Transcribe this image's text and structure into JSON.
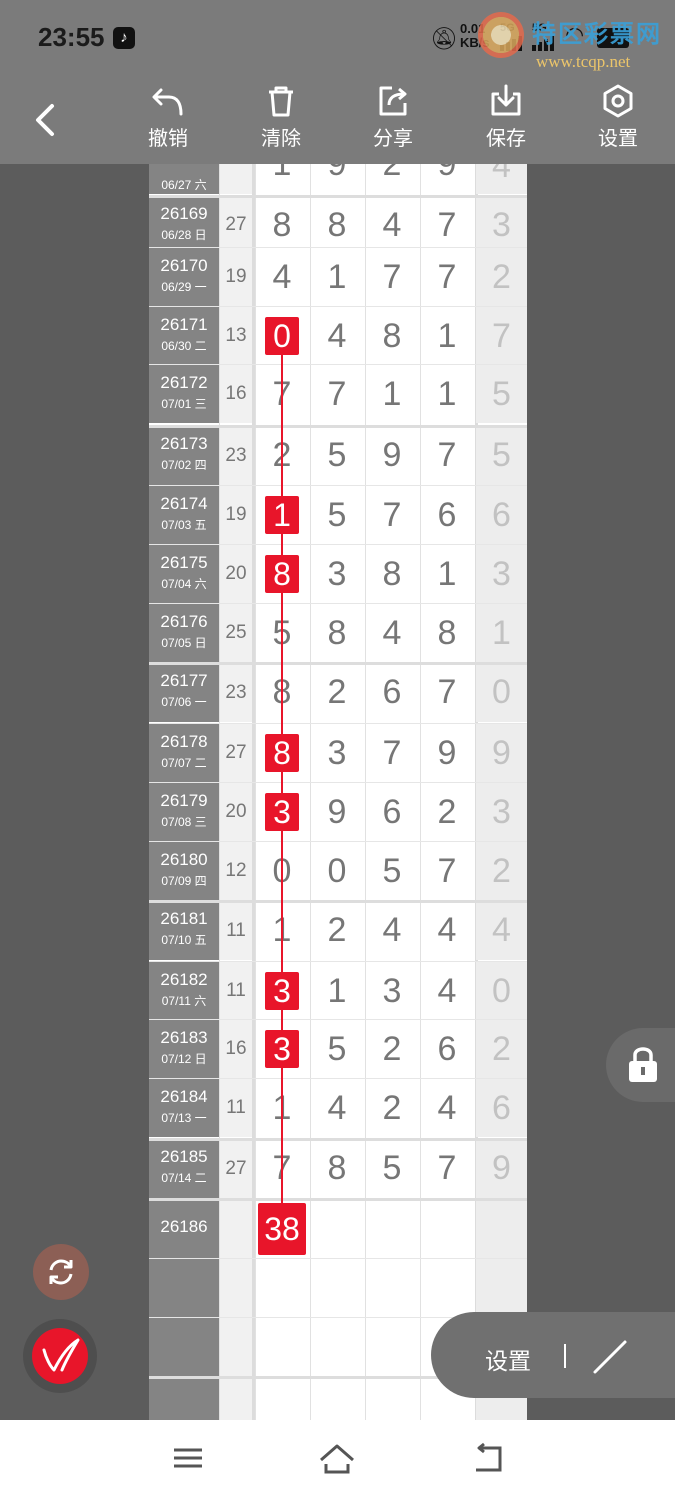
{
  "status_bar": {
    "time": "23:55",
    "net_speed_value": "0.01",
    "net_speed_unit": "KB/s",
    "net_type_1": "5G",
    "net_type_2": "5G",
    "battery": "100"
  },
  "watermark": {
    "brand": "特区彩票网",
    "url": "www.tcqp.net"
  },
  "toolbar": {
    "undo_label": "撤销",
    "clear_label": "清除",
    "share_label": "分享",
    "save_label": "保存",
    "settings_label": "设置"
  },
  "table": {
    "partial_top": {
      "period": "06/27 六",
      "digits": [
        "1",
        "9",
        "2",
        "9"
      ],
      "last": "4"
    },
    "rows": [
      {
        "period": "26169",
        "date": "06/28 日",
        "sum": "27",
        "digits": [
          "8",
          "8",
          "4",
          "7"
        ],
        "last": "3",
        "marked": false
      },
      {
        "period": "26170",
        "date": "06/29 一",
        "sum": "19",
        "digits": [
          "4",
          "1",
          "7",
          "7"
        ],
        "last": "2",
        "marked": false
      },
      {
        "period": "26171",
        "date": "06/30 二",
        "sum": "13",
        "digits": [
          "0",
          "4",
          "8",
          "1"
        ],
        "last": "7",
        "marked": true
      },
      {
        "period": "26172",
        "date": "07/01 三",
        "sum": "16",
        "digits": [
          "7",
          "7",
          "1",
          "1"
        ],
        "last": "5",
        "marked": false
      },
      {
        "period": "26173",
        "date": "07/02 四",
        "sum": "23",
        "digits": [
          "2",
          "5",
          "9",
          "7"
        ],
        "last": "5",
        "marked": false
      },
      {
        "period": "26174",
        "date": "07/03 五",
        "sum": "19",
        "digits": [
          "1",
          "5",
          "7",
          "6"
        ],
        "last": "6",
        "marked": true
      },
      {
        "period": "26175",
        "date": "07/04 六",
        "sum": "20",
        "digits": [
          "8",
          "3",
          "8",
          "1"
        ],
        "last": "3",
        "marked": true
      },
      {
        "period": "26176",
        "date": "07/05 日",
        "sum": "25",
        "digits": [
          "5",
          "8",
          "4",
          "8"
        ],
        "last": "1",
        "marked": false
      },
      {
        "period": "26177",
        "date": "07/06 一",
        "sum": "23",
        "digits": [
          "8",
          "2",
          "6",
          "7"
        ],
        "last": "0",
        "marked": false
      },
      {
        "period": "26178",
        "date": "07/07 二",
        "sum": "27",
        "digits": [
          "8",
          "3",
          "7",
          "9"
        ],
        "last": "9",
        "marked": true
      },
      {
        "period": "26179",
        "date": "07/08 三",
        "sum": "20",
        "digits": [
          "3",
          "9",
          "6",
          "2"
        ],
        "last": "3",
        "marked": true
      },
      {
        "period": "26180",
        "date": "07/09 四",
        "sum": "12",
        "digits": [
          "0",
          "0",
          "5",
          "7"
        ],
        "last": "2",
        "marked": false
      },
      {
        "period": "26181",
        "date": "07/10 五",
        "sum": "11",
        "digits": [
          "1",
          "2",
          "4",
          "4"
        ],
        "last": "4",
        "marked": false
      },
      {
        "period": "26182",
        "date": "07/11 六",
        "sum": "11",
        "digits": [
          "3",
          "1",
          "3",
          "4"
        ],
        "last": "0",
        "marked": true
      },
      {
        "period": "26183",
        "date": "07/12 日",
        "sum": "16",
        "digits": [
          "3",
          "5",
          "2",
          "6"
        ],
        "last": "2",
        "marked": true
      },
      {
        "period": "26184",
        "date": "07/13 一",
        "sum": "11",
        "digits": [
          "1",
          "4",
          "2",
          "4"
        ],
        "last": "6",
        "marked": false
      },
      {
        "period": "26185",
        "date": "07/14 二",
        "sum": "27",
        "digits": [
          "7",
          "8",
          "5",
          "7"
        ],
        "last": "9",
        "marked": false
      }
    ],
    "next_period": "26186",
    "next_mark": "38"
  },
  "floating": {
    "settings_label": "设置"
  },
  "colors": {
    "mark_red": "#e8152a",
    "toolbar_gray": "#7b7b7b",
    "period_gray": "#848484"
  }
}
